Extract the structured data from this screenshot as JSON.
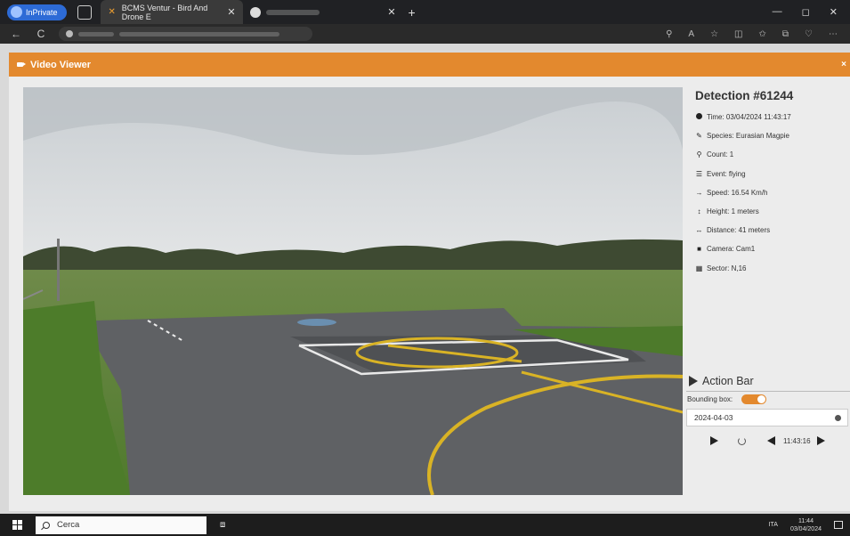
{
  "browser": {
    "inprivate_label": "InPrivate",
    "active_tab_title": "BCMS Ventur - Bird And Drone E",
    "tab_close_glyph": "✕",
    "second_tab_close_glyph": "✕",
    "new_tab_glyph": "+",
    "window_controls": [
      "—",
      "◻",
      "✕"
    ],
    "nav_back_glyph": "←",
    "nav_reload_glyph": "C"
  },
  "modal": {
    "title": "Video Viewer",
    "close_glyph": "×"
  },
  "detection": {
    "title": "Detection #61244",
    "fields": [
      {
        "icon": "clock-icon",
        "text": "Time: 03/04/2024 11:43:17"
      },
      {
        "icon": "feather-icon",
        "text": "Species: Eurasian Magpie"
      },
      {
        "icon": "map-pin-icon",
        "text": "Count: 1"
      },
      {
        "icon": "list-icon",
        "text": "Event: flying"
      },
      {
        "icon": "arrow-right-icon",
        "text": "Speed: 16.54 Km/h"
      },
      {
        "icon": "arrows-vertical-icon",
        "text": "Height: 1 meters"
      },
      {
        "icon": "arrows-horizontal-icon",
        "text": "Distance: 41 meters"
      },
      {
        "icon": "video-camera-icon",
        "text": "Camera: Cam1"
      },
      {
        "icon": "grid-icon",
        "text": "Sector: N,16"
      }
    ]
  },
  "action_bar": {
    "title": "Action Bar",
    "bounding_box_label": "Bounding box:",
    "bounding_box_enabled": true,
    "date_value": "2024-04-03",
    "current_time": "11:43:16"
  },
  "taskbar": {
    "search_placeholder": "Cerca",
    "language": "ITA",
    "clock_time": "11:44",
    "clock_date": "03/04/2024"
  },
  "colors": {
    "accent": "#e3892e",
    "modal_bg": "#ececec"
  }
}
